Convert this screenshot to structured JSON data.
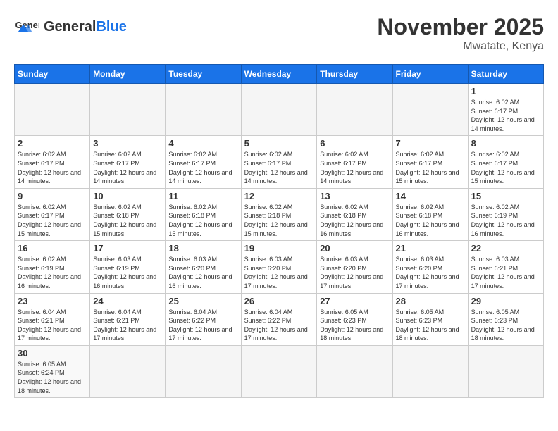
{
  "header": {
    "logo_general": "General",
    "logo_blue": "Blue",
    "month_title": "November 2025",
    "location": "Mwatate, Kenya"
  },
  "weekdays": [
    "Sunday",
    "Monday",
    "Tuesday",
    "Wednesday",
    "Thursday",
    "Friday",
    "Saturday"
  ],
  "weeks": [
    [
      {
        "day": "",
        "info": ""
      },
      {
        "day": "",
        "info": ""
      },
      {
        "day": "",
        "info": ""
      },
      {
        "day": "",
        "info": ""
      },
      {
        "day": "",
        "info": ""
      },
      {
        "day": "",
        "info": ""
      },
      {
        "day": "1",
        "info": "Sunrise: 6:02 AM\nSunset: 6:17 PM\nDaylight: 12 hours and 14 minutes."
      }
    ],
    [
      {
        "day": "2",
        "info": "Sunrise: 6:02 AM\nSunset: 6:17 PM\nDaylight: 12 hours and 14 minutes."
      },
      {
        "day": "3",
        "info": "Sunrise: 6:02 AM\nSunset: 6:17 PM\nDaylight: 12 hours and 14 minutes."
      },
      {
        "day": "4",
        "info": "Sunrise: 6:02 AM\nSunset: 6:17 PM\nDaylight: 12 hours and 14 minutes."
      },
      {
        "day": "5",
        "info": "Sunrise: 6:02 AM\nSunset: 6:17 PM\nDaylight: 12 hours and 14 minutes."
      },
      {
        "day": "6",
        "info": "Sunrise: 6:02 AM\nSunset: 6:17 PM\nDaylight: 12 hours and 14 minutes."
      },
      {
        "day": "7",
        "info": "Sunrise: 6:02 AM\nSunset: 6:17 PM\nDaylight: 12 hours and 15 minutes."
      },
      {
        "day": "8",
        "info": "Sunrise: 6:02 AM\nSunset: 6:17 PM\nDaylight: 12 hours and 15 minutes."
      }
    ],
    [
      {
        "day": "9",
        "info": "Sunrise: 6:02 AM\nSunset: 6:17 PM\nDaylight: 12 hours and 15 minutes."
      },
      {
        "day": "10",
        "info": "Sunrise: 6:02 AM\nSunset: 6:18 PM\nDaylight: 12 hours and 15 minutes."
      },
      {
        "day": "11",
        "info": "Sunrise: 6:02 AM\nSunset: 6:18 PM\nDaylight: 12 hours and 15 minutes."
      },
      {
        "day": "12",
        "info": "Sunrise: 6:02 AM\nSunset: 6:18 PM\nDaylight: 12 hours and 15 minutes."
      },
      {
        "day": "13",
        "info": "Sunrise: 6:02 AM\nSunset: 6:18 PM\nDaylight: 12 hours and 16 minutes."
      },
      {
        "day": "14",
        "info": "Sunrise: 6:02 AM\nSunset: 6:18 PM\nDaylight: 12 hours and 16 minutes."
      },
      {
        "day": "15",
        "info": "Sunrise: 6:02 AM\nSunset: 6:19 PM\nDaylight: 12 hours and 16 minutes."
      }
    ],
    [
      {
        "day": "16",
        "info": "Sunrise: 6:02 AM\nSunset: 6:19 PM\nDaylight: 12 hours and 16 minutes."
      },
      {
        "day": "17",
        "info": "Sunrise: 6:03 AM\nSunset: 6:19 PM\nDaylight: 12 hours and 16 minutes."
      },
      {
        "day": "18",
        "info": "Sunrise: 6:03 AM\nSunset: 6:20 PM\nDaylight: 12 hours and 16 minutes."
      },
      {
        "day": "19",
        "info": "Sunrise: 6:03 AM\nSunset: 6:20 PM\nDaylight: 12 hours and 17 minutes."
      },
      {
        "day": "20",
        "info": "Sunrise: 6:03 AM\nSunset: 6:20 PM\nDaylight: 12 hours and 17 minutes."
      },
      {
        "day": "21",
        "info": "Sunrise: 6:03 AM\nSunset: 6:20 PM\nDaylight: 12 hours and 17 minutes."
      },
      {
        "day": "22",
        "info": "Sunrise: 6:03 AM\nSunset: 6:21 PM\nDaylight: 12 hours and 17 minutes."
      }
    ],
    [
      {
        "day": "23",
        "info": "Sunrise: 6:04 AM\nSunset: 6:21 PM\nDaylight: 12 hours and 17 minutes."
      },
      {
        "day": "24",
        "info": "Sunrise: 6:04 AM\nSunset: 6:21 PM\nDaylight: 12 hours and 17 minutes."
      },
      {
        "day": "25",
        "info": "Sunrise: 6:04 AM\nSunset: 6:22 PM\nDaylight: 12 hours and 17 minutes."
      },
      {
        "day": "26",
        "info": "Sunrise: 6:04 AM\nSunset: 6:22 PM\nDaylight: 12 hours and 17 minutes."
      },
      {
        "day": "27",
        "info": "Sunrise: 6:05 AM\nSunset: 6:23 PM\nDaylight: 12 hours and 18 minutes."
      },
      {
        "day": "28",
        "info": "Sunrise: 6:05 AM\nSunset: 6:23 PM\nDaylight: 12 hours and 18 minutes."
      },
      {
        "day": "29",
        "info": "Sunrise: 6:05 AM\nSunset: 6:23 PM\nDaylight: 12 hours and 18 minutes."
      }
    ],
    [
      {
        "day": "30",
        "info": "Sunrise: 6:05 AM\nSunset: 6:24 PM\nDaylight: 12 hours and 18 minutes."
      },
      {
        "day": "",
        "info": ""
      },
      {
        "day": "",
        "info": ""
      },
      {
        "day": "",
        "info": ""
      },
      {
        "day": "",
        "info": ""
      },
      {
        "day": "",
        "info": ""
      },
      {
        "day": "",
        "info": ""
      }
    ]
  ]
}
